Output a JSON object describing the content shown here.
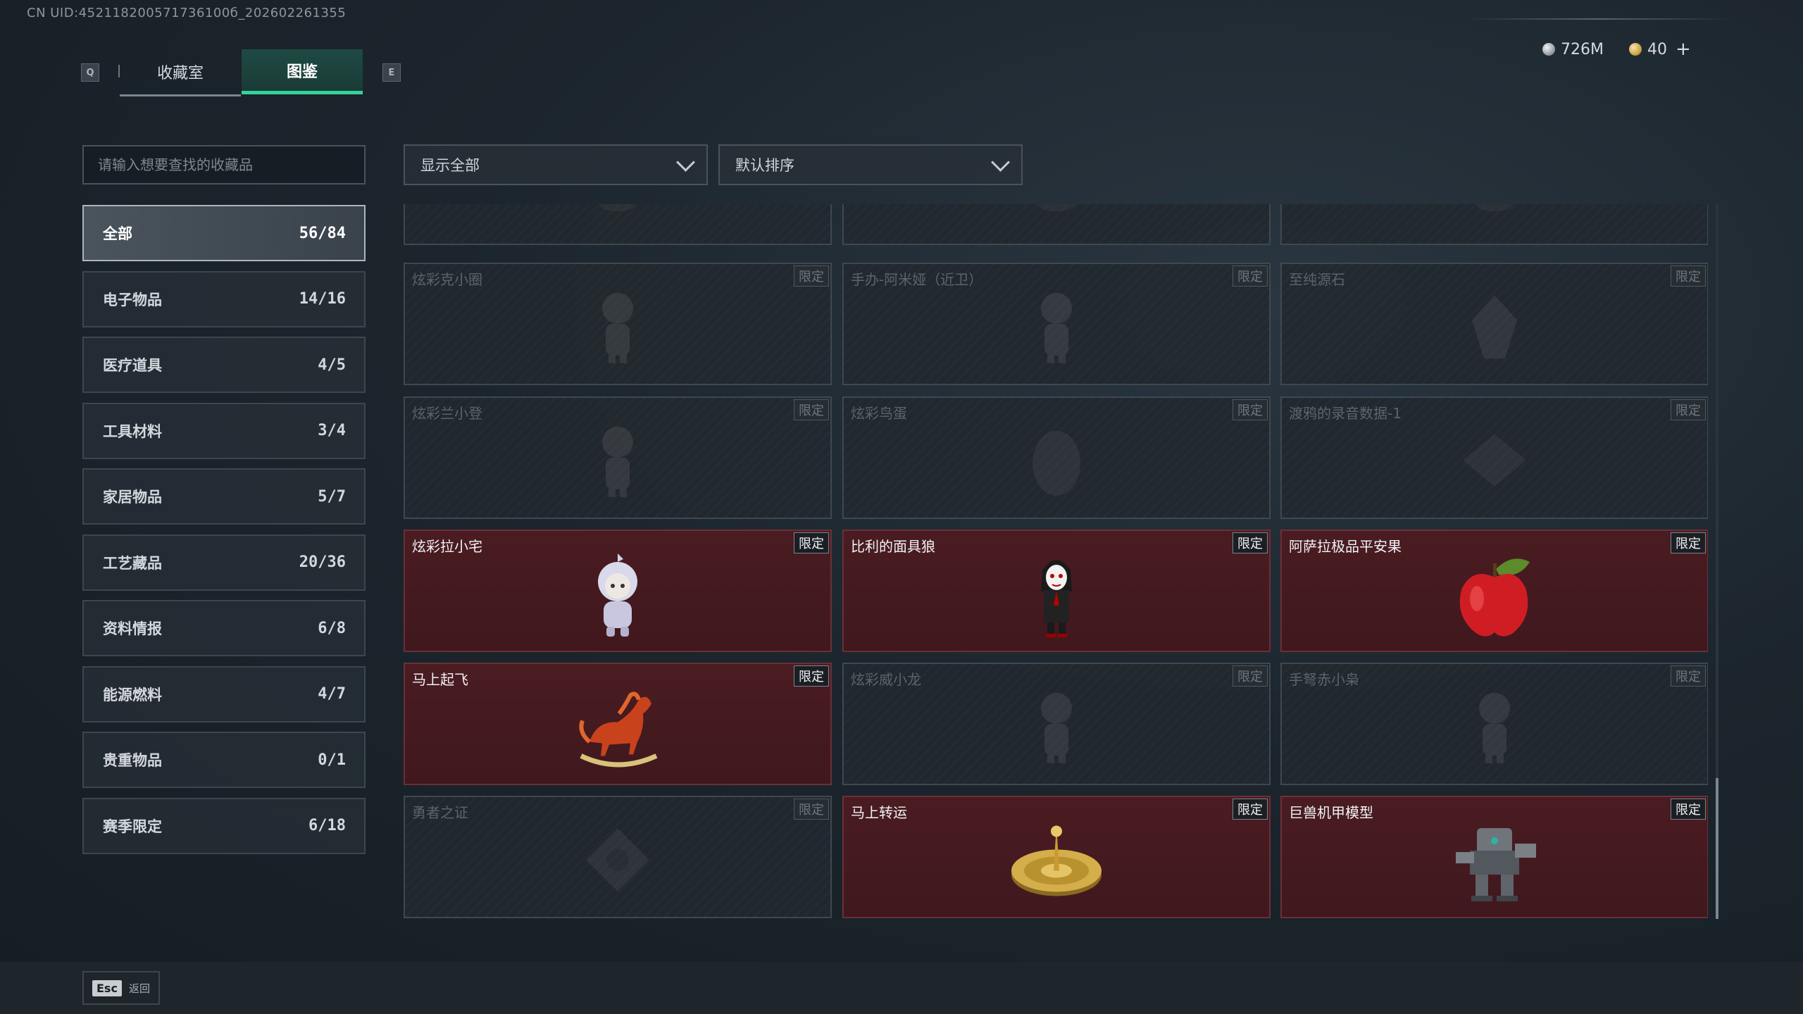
{
  "uid": "CN UID:452118200571736100б_202602261355",
  "tabs": {
    "prev_key": "Q",
    "next_key": "E",
    "items": [
      {
        "label": "收藏室"
      },
      {
        "label": "图鉴"
      }
    ],
    "active": "图鉴"
  },
  "currency": {
    "silver": "726M",
    "gold": "40",
    "add": "+"
  },
  "search": {
    "placeholder": "请输入想要查找的收藏品",
    "value": ""
  },
  "filters": {
    "show": "显示全部",
    "sort": "默认排序"
  },
  "categories": [
    {
      "label": "全部",
      "count": "56/84",
      "active": true
    },
    {
      "label": "电子物品",
      "count": "14/16"
    },
    {
      "label": "医疗道具",
      "count": "4/5"
    },
    {
      "label": "工具材料",
      "count": "3/4"
    },
    {
      "label": "家居物品",
      "count": "5/7"
    },
    {
      "label": "工艺藏品",
      "count": "20/36"
    },
    {
      "label": "资料情报",
      "count": "6/8"
    },
    {
      "label": "能源燃料",
      "count": "4/7"
    },
    {
      "label": "贵重物品",
      "count": "0/1"
    },
    {
      "label": "赛季限定",
      "count": "6/18"
    }
  ],
  "items": [
    {
      "name": "",
      "badge": "",
      "owned": false,
      "icon": "partial-item-icon"
    },
    {
      "name": "",
      "badge": "",
      "owned": false,
      "icon": "partial-item-icon"
    },
    {
      "name": "",
      "badge": "",
      "owned": false,
      "icon": "partial-item-icon"
    },
    {
      "name": "炫彩克小圈",
      "badge": "限定",
      "owned": false,
      "icon": "figurine-icon"
    },
    {
      "name": "手办-阿米娅（近卫）",
      "badge": "限定",
      "owned": false,
      "icon": "figurine-icon"
    },
    {
      "name": "至纯源石",
      "badge": "限定",
      "owned": false,
      "icon": "crystal-icon"
    },
    {
      "name": "炫彩兰小登",
      "badge": "限定",
      "owned": false,
      "icon": "figurine-icon"
    },
    {
      "name": "炫彩鸟蛋",
      "badge": "限定",
      "owned": false,
      "icon": "egg-icon"
    },
    {
      "name": "渡鸦的录音数据-1",
      "badge": "限定",
      "owned": false,
      "icon": "data-chip-icon"
    },
    {
      "name": "炫彩拉小宅",
      "badge": "限定",
      "owned": true,
      "icon": "hooded-figurine-icon"
    },
    {
      "name": "比利的面具狼",
      "badge": "限定",
      "owned": true,
      "icon": "puppet-doll-icon"
    },
    {
      "name": "阿萨拉极品平安果",
      "badge": "限定",
      "owned": true,
      "icon": "red-apple-icon"
    },
    {
      "name": "马上起飞",
      "badge": "限定",
      "owned": true,
      "icon": "rocking-horse-icon"
    },
    {
      "name": "炫彩威小龙",
      "badge": "限定",
      "owned": false,
      "icon": "figurine-icon"
    },
    {
      "name": "手弩赤小枭",
      "badge": "限定",
      "owned": false,
      "icon": "figurine-icon"
    },
    {
      "name": "勇者之证",
      "badge": "限定",
      "owned": false,
      "icon": "medal-icon"
    },
    {
      "name": "马上转运",
      "badge": "限定",
      "owned": true,
      "icon": "gold-compass-icon"
    },
    {
      "name": "巨兽机甲模型",
      "badge": "限定",
      "owned": true,
      "icon": "mech-model-icon"
    }
  ],
  "footer": {
    "key": "Esc",
    "label": "返回"
  }
}
